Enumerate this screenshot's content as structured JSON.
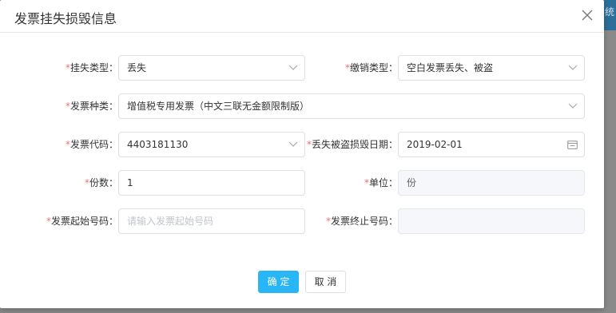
{
  "background": {
    "topbar_color": "#2c6f98",
    "overlay_text": "统"
  },
  "dialog": {
    "title": "发票挂失损毁信息",
    "close_icon": "close-icon"
  },
  "form": {
    "loss_type": {
      "label": "挂失类型：",
      "value": "丢失"
    },
    "cancel_type": {
      "label": "缴销类型：",
      "value": "空白发票丢失、被盗"
    },
    "invoice_kind": {
      "label": "发票种类：",
      "value": "增值税专用发票（中文三联无金额限制版）"
    },
    "invoice_code": {
      "label": "发票代码：",
      "value": "4403181130"
    },
    "loss_date": {
      "label": "丢失被盗损毁日期：",
      "value": "2019-02-01"
    },
    "quantity": {
      "label": "份数：",
      "value": "1"
    },
    "unit": {
      "label": "单位：",
      "value": "份"
    },
    "start_number": {
      "label": "发票起始号码：",
      "value": "",
      "placeholder": "请输入发票起始号码"
    },
    "end_number": {
      "label": "发票终止号码：",
      "value": ""
    }
  },
  "footer": {
    "confirm_label": "确 定",
    "cancel_label": "取 消"
  },
  "colors": {
    "primary": "#29b6f6",
    "required": "#f56c6c",
    "border": "#dcdfe6"
  }
}
